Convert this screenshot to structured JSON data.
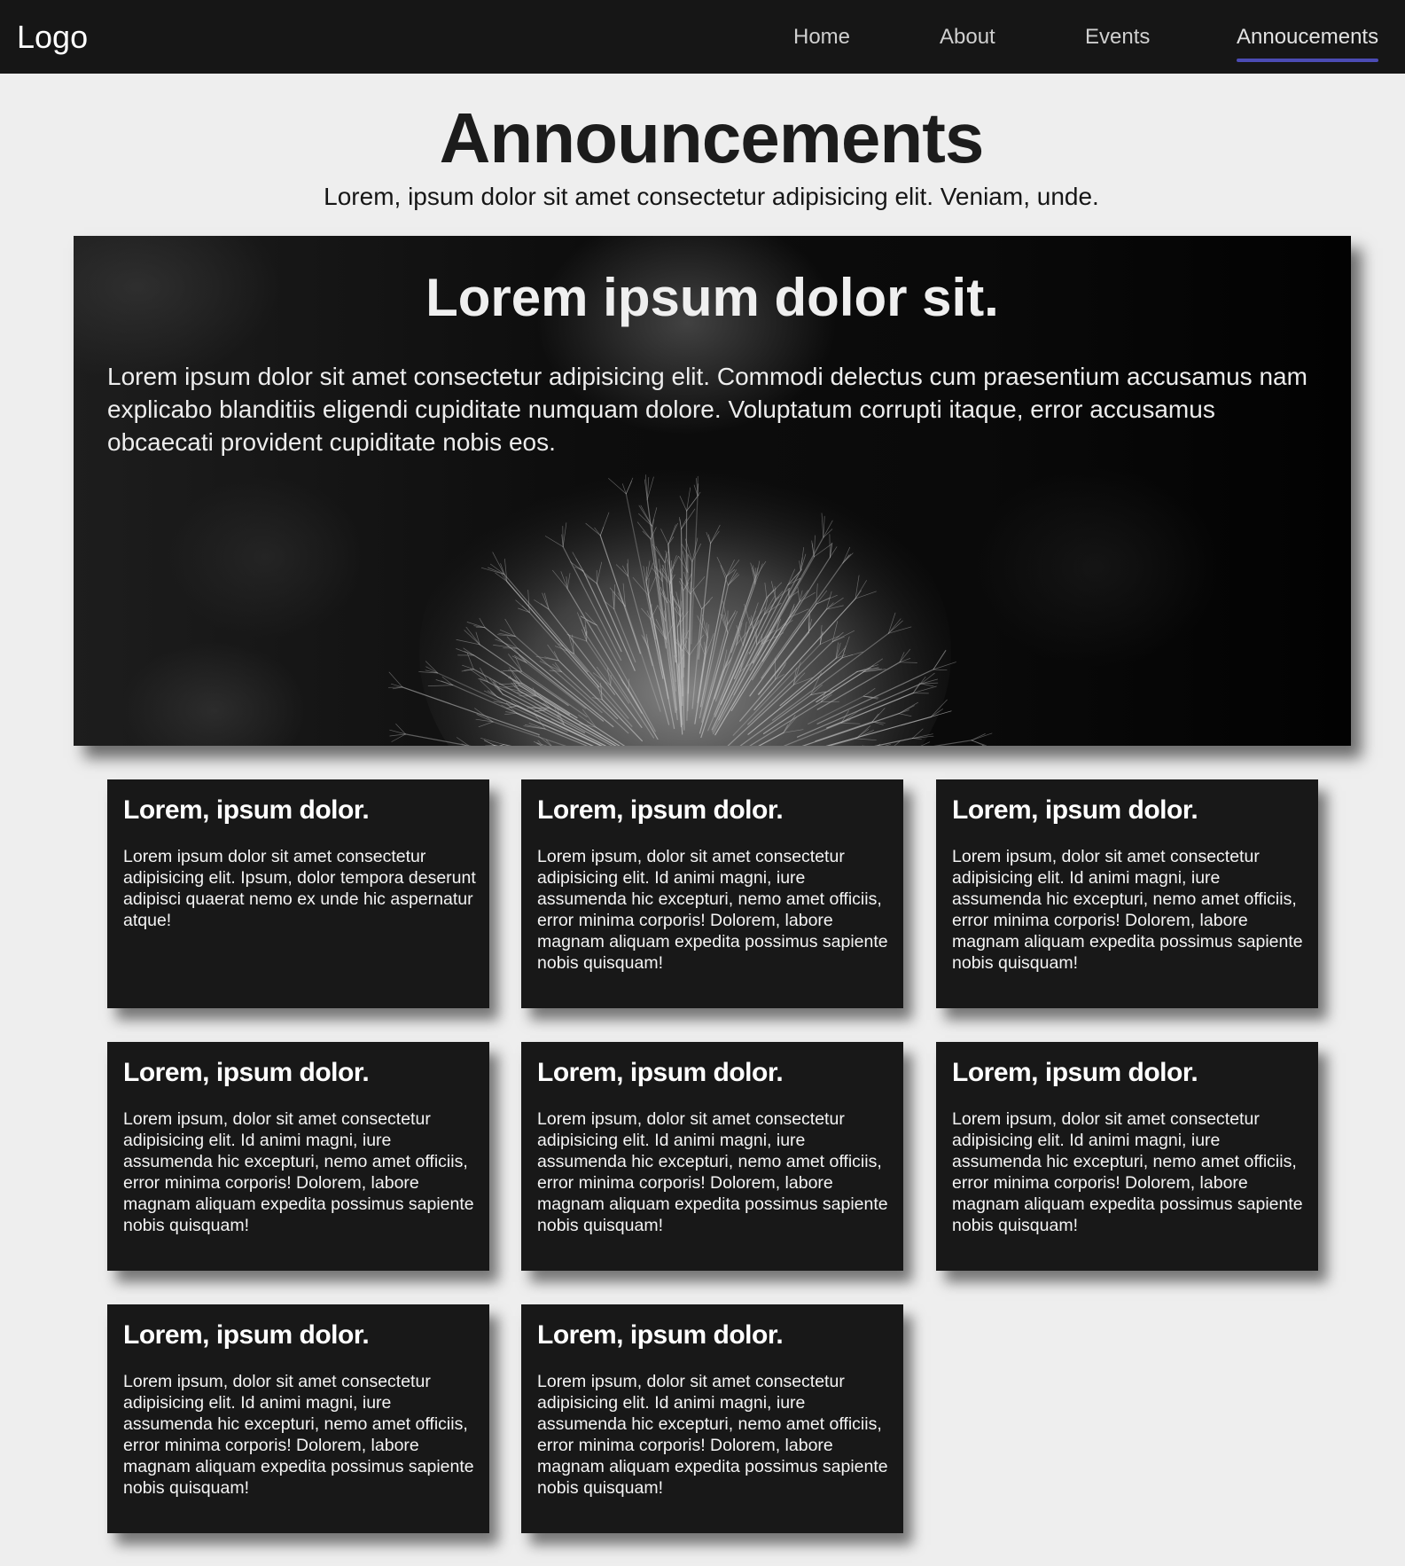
{
  "nav": {
    "logo": "Logo",
    "links": [
      {
        "label": "Home",
        "active": false
      },
      {
        "label": "About",
        "active": false
      },
      {
        "label": "Events",
        "active": false
      },
      {
        "label": "Annoucements",
        "active": true
      }
    ]
  },
  "header": {
    "title": "Announcements",
    "subtitle": "Lorem, ipsum dolor sit amet consectetur adipisicing elit. Veniam, unde."
  },
  "hero": {
    "title": "Lorem ipsum dolor sit.",
    "text": "Lorem ipsum dolor sit amet consectetur adipisicing elit. Commodi delectus cum praesentium accusamus nam explicabo blanditiis eligendi cupiditate numquam dolore. Voluptatum corrupti itaque, error accusamus obcaecati provident cupiditate nobis eos."
  },
  "cards": [
    {
      "title": "Lorem, ipsum dolor.",
      "text": "Lorem ipsum dolor sit amet consectetur adipisicing elit. Ipsum, dolor tempora deserunt adipisci quaerat nemo ex unde hic aspernatur atque!"
    },
    {
      "title": "Lorem, ipsum dolor.",
      "text": "Lorem ipsum, dolor sit amet consectetur adipisicing elit. Id animi magni, iure assumenda hic excepturi, nemo amet officiis, error minima corporis! Dolorem, labore magnam aliquam expedita possimus sapiente nobis quisquam!"
    },
    {
      "title": "Lorem, ipsum dolor.",
      "text": "Lorem ipsum, dolor sit amet consectetur adipisicing elit. Id animi magni, iure assumenda hic excepturi, nemo amet officiis, error minima corporis! Dolorem, labore magnam aliquam expedita possimus sapiente nobis quisquam!"
    },
    {
      "title": "Lorem, ipsum dolor.",
      "text": "Lorem ipsum, dolor sit amet consectetur adipisicing elit. Id animi magni, iure assumenda hic excepturi, nemo amet officiis, error minima corporis! Dolorem, labore magnam aliquam expedita possimus sapiente nobis quisquam!"
    },
    {
      "title": "Lorem, ipsum dolor.",
      "text": "Lorem ipsum, dolor sit amet consectetur adipisicing elit. Id animi magni, iure assumenda hic excepturi, nemo amet officiis, error minima corporis! Dolorem, labore magnam aliquam expedita possimus sapiente nobis quisquam!"
    },
    {
      "title": "Lorem, ipsum dolor.",
      "text": "Lorem ipsum, dolor sit amet consectetur adipisicing elit. Id animi magni, iure assumenda hic excepturi, nemo amet officiis, error minima corporis! Dolorem, labore magnam aliquam expedita possimus sapiente nobis quisquam!"
    },
    {
      "title": "Lorem, ipsum dolor.",
      "text": "Lorem ipsum, dolor sit amet consectetur adipisicing elit. Id animi magni, iure assumenda hic excepturi, nemo amet officiis, error minima corporis! Dolorem, labore magnam aliquam expedita possimus sapiente nobis quisquam!"
    },
    {
      "title": "Lorem, ipsum dolor.",
      "text": "Lorem ipsum, dolor sit amet consectetur adipisicing elit. Id animi magni, iure assumenda hic excepturi, nemo amet officiis, error minima corporis! Dolorem, labore magnam aliquam expedita possimus sapiente nobis quisquam!"
    }
  ],
  "colors": {
    "nav_background": "#161616",
    "active_underline": "#4b4bb4",
    "page_background": "#eeeeee",
    "card_background": "#181818"
  },
  "icons": {
    "hero_image": "dandelion-photo"
  }
}
